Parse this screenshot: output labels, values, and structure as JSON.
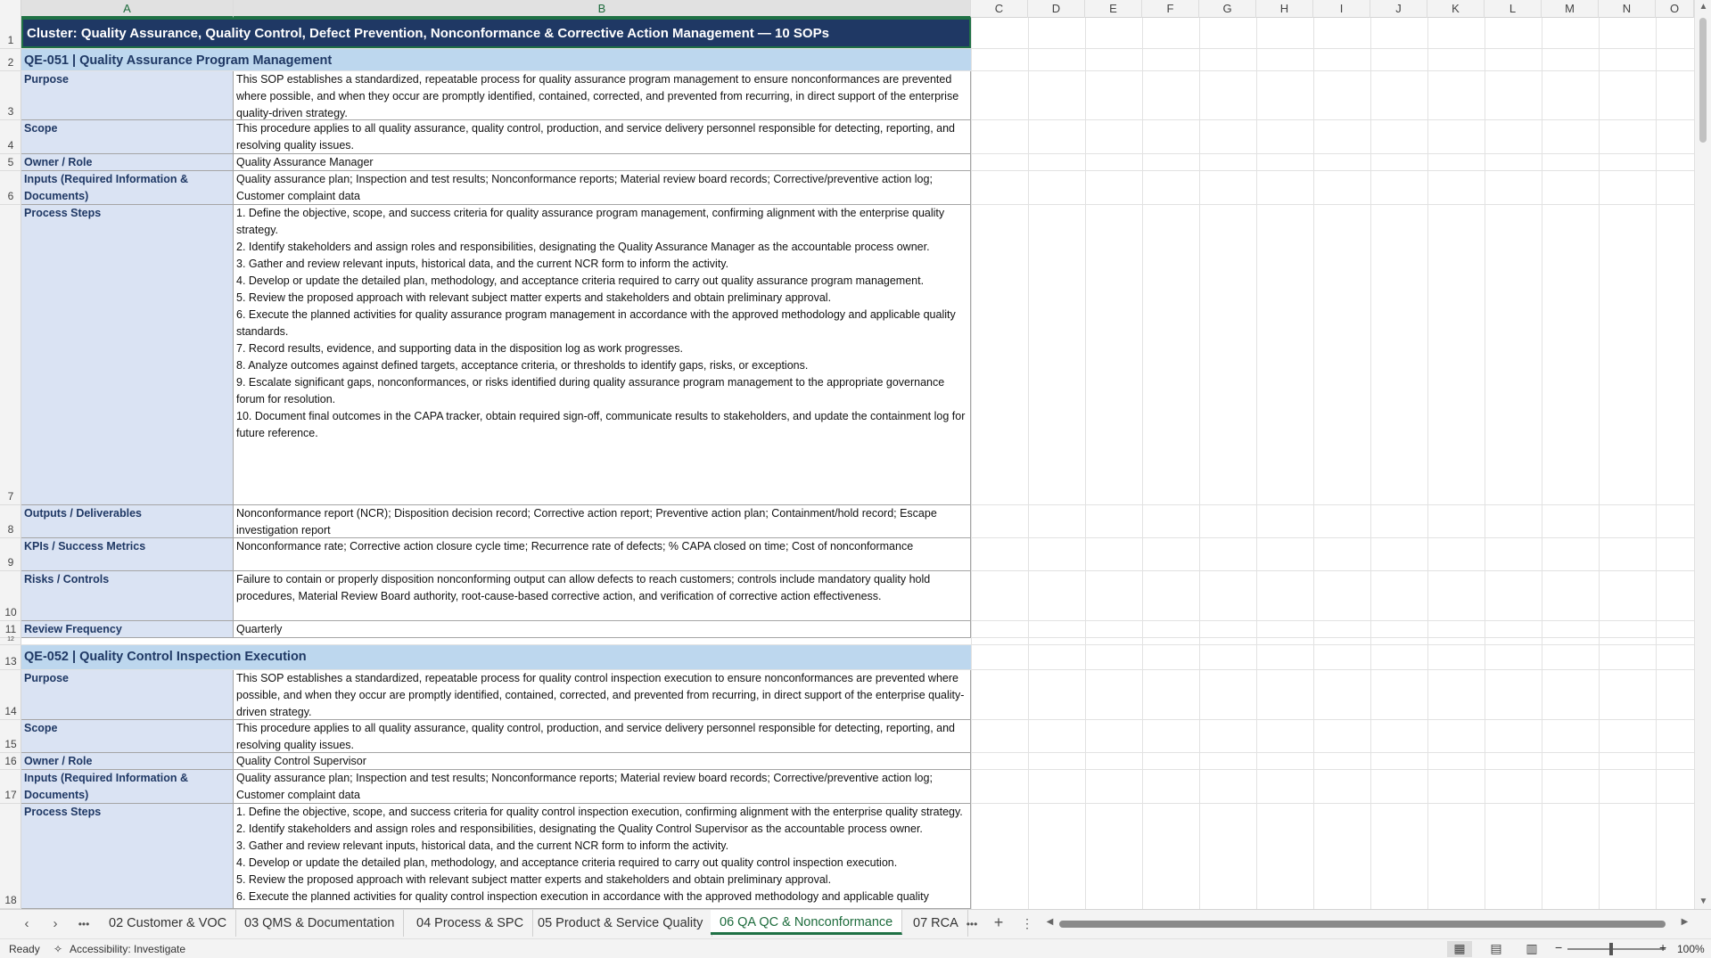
{
  "columns": [
    "A",
    "B",
    "C",
    "D",
    "E",
    "F",
    "G",
    "H",
    "I",
    "J",
    "K",
    "L",
    "M",
    "N",
    "O"
  ],
  "rows": [
    "1",
    "2",
    "3",
    "4",
    "5",
    "6",
    "7",
    "8",
    "9",
    "10",
    "11",
    "12",
    "13",
    "14",
    "15",
    "16",
    "17",
    "18"
  ],
  "title": "Cluster: Quality Assurance, Quality Control, Defect Prevention, Nonconformance & Corrective Action Management  —  10 SOPs",
  "sops": [
    {
      "header": "QE-051  |  Quality Assurance Program Management",
      "purpose_label": "Purpose",
      "purpose": "This SOP establishes a standardized, repeatable process for quality assurance program management to ensure nonconformances are prevented where possible, and when they occur are promptly identified, contained, corrected, and prevented from recurring, in direct support of the enterprise quality-driven strategy.",
      "scope_label": "Scope",
      "scope": "This procedure applies to all quality assurance, quality control, production, and service delivery personnel responsible for detecting, reporting, and resolving quality issues.",
      "owner_label": "Owner / Role",
      "owner": "Quality Assurance Manager",
      "inputs_label": "Inputs (Required Information & Documents)",
      "inputs": "Quality assurance plan; Inspection and test results; Nonconformance reports; Material review board records; Corrective/preventive action log; Customer complaint data",
      "steps_label": "Process Steps",
      "steps": [
        "1. Define the objective, scope, and success criteria for quality assurance program management, confirming alignment with the enterprise quality strategy.",
        "2. Identify stakeholders and assign roles and responsibilities, designating the Quality Assurance Manager as the accountable process owner.",
        "3. Gather and review relevant inputs, historical data, and the current NCR form to inform the activity.",
        "4. Develop or update the detailed plan, methodology, and acceptance criteria required to carry out quality assurance program management.",
        "5. Review the proposed approach with relevant subject matter experts and stakeholders and obtain preliminary approval.",
        "6. Execute the planned activities for quality assurance program management in accordance with the approved methodology and applicable quality standards.",
        "7. Record results, evidence, and supporting data in the disposition log as work progresses.",
        "8. Analyze outcomes against defined targets, acceptance criteria, or thresholds to identify gaps, risks, or exceptions.",
        "9. Escalate significant gaps, nonconformances, or risks identified during quality assurance program management to the appropriate governance forum for resolution.",
        "10. Document final outcomes in the CAPA tracker, obtain required sign-off, communicate results to stakeholders, and update the containment log for future reference."
      ],
      "outputs_label": "Outputs / Deliverables",
      "outputs": "Nonconformance report (NCR); Disposition decision record; Corrective action report; Preventive action plan; Containment/hold record; Escape investigation report",
      "kpis_label": "KPIs / Success Metrics",
      "kpis": "Nonconformance rate; Corrective action closure cycle time; Recurrence rate of defects; % CAPA closed on time; Cost of nonconformance",
      "risks_label": "Risks / Controls",
      "risks": "Failure to contain or properly disposition nonconforming output can allow defects to reach customers; controls include mandatory quality hold procedures, Material Review Board authority, root-cause-based corrective action, and verification of corrective action effectiveness.",
      "review_label": "Review Frequency",
      "review": "Quarterly"
    },
    {
      "header": "QE-052  |  Quality Control Inspection Execution",
      "purpose_label": "Purpose",
      "purpose": "This SOP establishes a standardized, repeatable process for quality control inspection execution to ensure nonconformances are prevented where possible, and when they occur are promptly identified, contained, corrected, and prevented from recurring, in direct support of the enterprise quality-driven strategy.",
      "scope_label": "Scope",
      "scope": "This procedure applies to all quality assurance, quality control, production, and service delivery personnel responsible for detecting, reporting, and resolving quality issues.",
      "owner_label": "Owner / Role",
      "owner": "Quality Control Supervisor",
      "inputs_label": "Inputs (Required Information & Documents)",
      "inputs": "Quality assurance plan; Inspection and test results; Nonconformance reports; Material review board records; Corrective/preventive action log; Customer complaint data",
      "steps_label": "Process Steps",
      "steps": [
        "1. Define the objective, scope, and success criteria for quality control inspection execution, confirming alignment with the enterprise quality strategy.",
        "2. Identify stakeholders and assign roles and responsibilities, designating the Quality Control Supervisor as the accountable process owner.",
        "3. Gather and review relevant inputs, historical data, and the current NCR form to inform the activity.",
        "4. Develop or update the detailed plan, methodology, and acceptance criteria required to carry out quality control inspection execution.",
        "5. Review the proposed approach with relevant subject matter experts and stakeholders and obtain preliminary approval.",
        "6. Execute the planned activities for quality control inspection execution in accordance with the approved methodology and applicable quality"
      ]
    }
  ],
  "sheet_tabs": [
    "02 Customer & VOC",
    "03 QMS & Documentation",
    "04 Process & SPC",
    "05 Product & Service Quality",
    "06 QA QC & Nonconformance",
    "07 RCA"
  ],
  "active_tab": "06 QA QC & Nonconformance",
  "status": {
    "ready": "Ready",
    "accessibility": "Accessibility: Investigate",
    "zoom": "100%"
  },
  "icons": {
    "nav_prev": "chevron-left-icon",
    "nav_next": "chevron-right-icon",
    "more": "ellipsis-icon",
    "add_sheet": "plus-icon",
    "normal_view": "grid-icon",
    "page_layout": "page-layout-icon",
    "page_break": "page-break-icon"
  },
  "colors": {
    "title_bg": "#1f3864",
    "sop_header_bg": "#bdd7ee",
    "label_bg": "#dae3f3",
    "accent": "#1f7145"
  }
}
